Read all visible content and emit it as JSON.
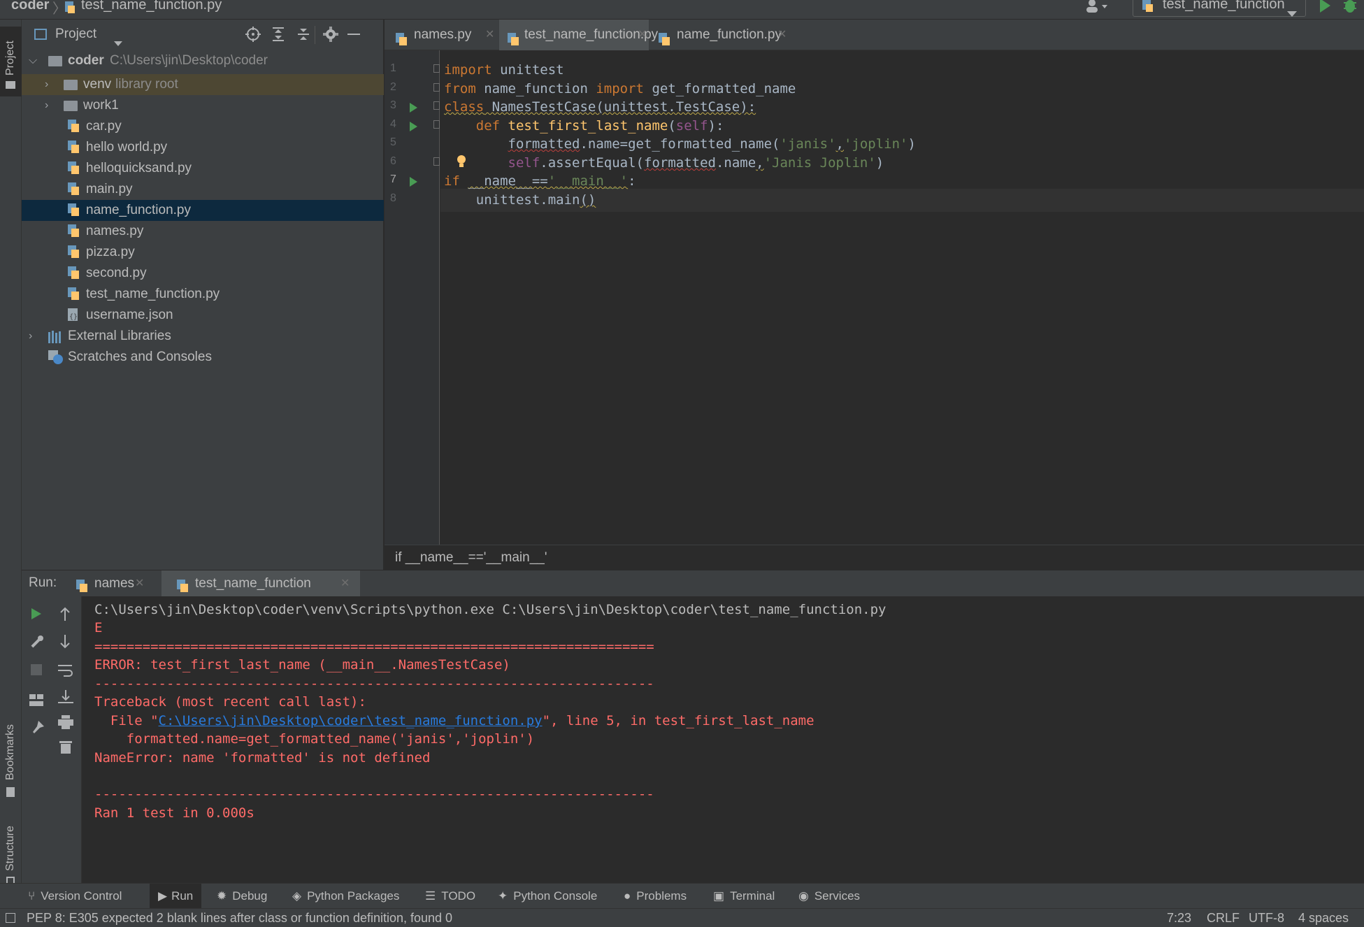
{
  "nav": {
    "project": "coder",
    "file": "test_name_function.py",
    "run_config": "test_name_function"
  },
  "left_stripe": {
    "project": "Project",
    "bookmarks": "Bookmarks",
    "structure": "Structure"
  },
  "project_panel": {
    "title": "Project",
    "tree": [
      {
        "label": "coder",
        "hint": "C:\\Users\\jin\\Desktop\\coder",
        "kind": "folder-open"
      },
      {
        "label": "venv",
        "hint": "library root",
        "kind": "folder"
      },
      {
        "label": "work1",
        "hint": "",
        "kind": "folder"
      },
      {
        "label": "car.py",
        "hint": "",
        "kind": "py"
      },
      {
        "label": "hello world.py",
        "hint": "",
        "kind": "py"
      },
      {
        "label": "helloquicksand.py",
        "hint": "",
        "kind": "py"
      },
      {
        "label": "main.py",
        "hint": "",
        "kind": "py"
      },
      {
        "label": "name_function.py",
        "hint": "",
        "kind": "py",
        "selected": true
      },
      {
        "label": "names.py",
        "hint": "",
        "kind": "py"
      },
      {
        "label": "pizza.py",
        "hint": "",
        "kind": "py"
      },
      {
        "label": "second.py",
        "hint": "",
        "kind": "py"
      },
      {
        "label": "test_name_function.py",
        "hint": "",
        "kind": "py"
      },
      {
        "label": "username.json",
        "hint": "",
        "kind": "json"
      },
      {
        "label": "External Libraries",
        "hint": "",
        "kind": "lib"
      },
      {
        "label": "Scratches and Consoles",
        "hint": "",
        "kind": "scratch"
      }
    ]
  },
  "editor": {
    "tabs": [
      {
        "label": "names.py",
        "active": false
      },
      {
        "label": "test_name_function.py",
        "active": true
      },
      {
        "label": "name_function.py",
        "active": false
      }
    ],
    "line_numbers": [
      "1",
      "2",
      "3",
      "4",
      "5",
      "6",
      "7",
      "8"
    ],
    "breadcrumb": "if __name__=='__main__'"
  },
  "run": {
    "label": "Run:",
    "tabs": [
      {
        "label": "names",
        "active": false
      },
      {
        "label": "test_name_function",
        "active": true
      }
    ],
    "console": {
      "cmd": "C:\\Users\\jin\\Desktop\\coder\\venv\\Scripts\\python.exe C:\\Users\\jin\\Desktop\\coder\\test_name_function.py",
      "e": "E",
      "sep_eq": "======================================================================",
      "error": "ERROR: test_first_last_name (__main__.NamesTestCase)",
      "sep_dash": "----------------------------------------------------------------------",
      "traceback": "Traceback (most recent call last):",
      "file_prefix": "  File \"",
      "file_link": "C:\\Users\\jin\\Desktop\\coder\\test_name_function.py",
      "file_suffix": "\", line 5, in test_first_last_name",
      "code_line": "    formatted.name=get_formatted_name('janis','joplin')",
      "name_error": "NameError: name 'formatted' is not defined",
      "sep_dash2": "----------------------------------------------------------------------",
      "ran": "Ran 1 test in 0.000s"
    }
  },
  "tool_windows": [
    "Version Control",
    "Run",
    "Debug",
    "Python Packages",
    "TODO",
    "Python Console",
    "Problems",
    "Terminal",
    "Services"
  ],
  "status": {
    "message": "PEP 8: E305 expected 2 blank lines after class or function definition, found 0",
    "position": "7:23",
    "line_sep": "CRLF",
    "encoding": "UTF-8",
    "indent": "4 spaces"
  },
  "colors": {
    "accent": "#4a88c7",
    "run_green": "#499c54",
    "error_red": "#ff6b68",
    "keyword": "#cc7832",
    "string": "#6a8759",
    "function": "#ffc66d"
  }
}
